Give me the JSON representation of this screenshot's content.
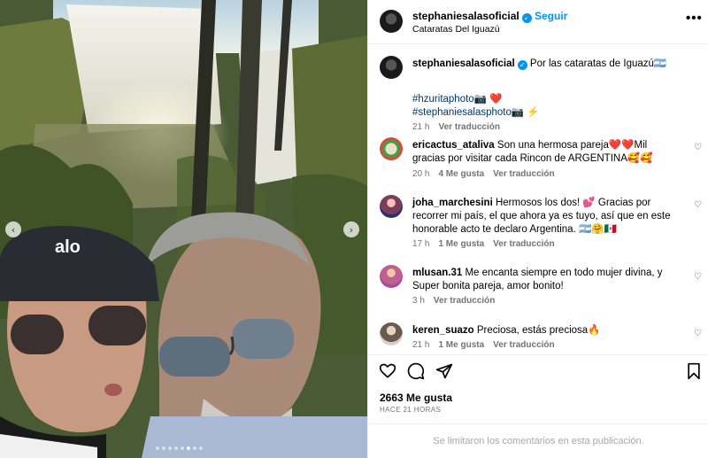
{
  "post": {
    "username": "stephaniesalasoficial",
    "follow_label": "Seguir",
    "separator": "•",
    "location": "Cataratas Del Iguazú",
    "more_label": "•••"
  },
  "caption": {
    "username": "stephaniesalasoficial",
    "text": "Por las cataratas de Iguazú🇦🇷",
    "line2": "#hzuritaphoto📷 ❤️",
    "line3": "#stephaniesalasphoto📷 ⚡",
    "time": "21 h",
    "translate": "Ver traducción"
  },
  "comments": [
    {
      "username": "ericactus_ataliva",
      "text": "Son una hermosa pareja❤️❤️Mil gracias por visitar cada Rincon de ARGENTINA🥰🥰",
      "time": "20 h",
      "likes": "4 Me gusta",
      "translate": "Ver traducción"
    },
    {
      "username": "joha_marchesini",
      "text": "Hermosos los dos! 💕 Gracias por recorrer mi país, el que ahora ya es tuyo, así que en este honorable acto te declaro Argentina. 🇦🇷🤗🇲🇽",
      "time": "17 h",
      "likes": "1 Me gusta",
      "translate": "Ver traducción"
    },
    {
      "username": "mlusan.31",
      "text": "Me encanta siempre en todo mujer divina, y Super bonita pareja, amor bonito!",
      "time": "3 h",
      "likes": "",
      "translate": "Ver traducción"
    },
    {
      "username": "keren_suazo",
      "text": "Preciosa, estás preciosa🔥",
      "time": "21 h",
      "likes": "1 Me gusta",
      "translate": "Ver traducción"
    }
  ],
  "actions": {
    "likes": "2663 Me gusta",
    "ago": "HACE 21 HORAS"
  },
  "footer": {
    "limited_text": "Se limitaron los comentarios en esta publicación."
  },
  "photo": {
    "cap_text": "alo",
    "nav_prev": "‹",
    "nav_next": "›"
  },
  "colors": {
    "accent": "#0095f6",
    "muted": "#737373",
    "hashtag": "#00376b",
    "border": "#efefef"
  },
  "icons": [
    "verified-badge-icon",
    "more-options-icon",
    "heart-icon",
    "comment-icon",
    "share-icon",
    "bookmark-icon",
    "chevron-left-icon",
    "chevron-right-icon"
  ]
}
